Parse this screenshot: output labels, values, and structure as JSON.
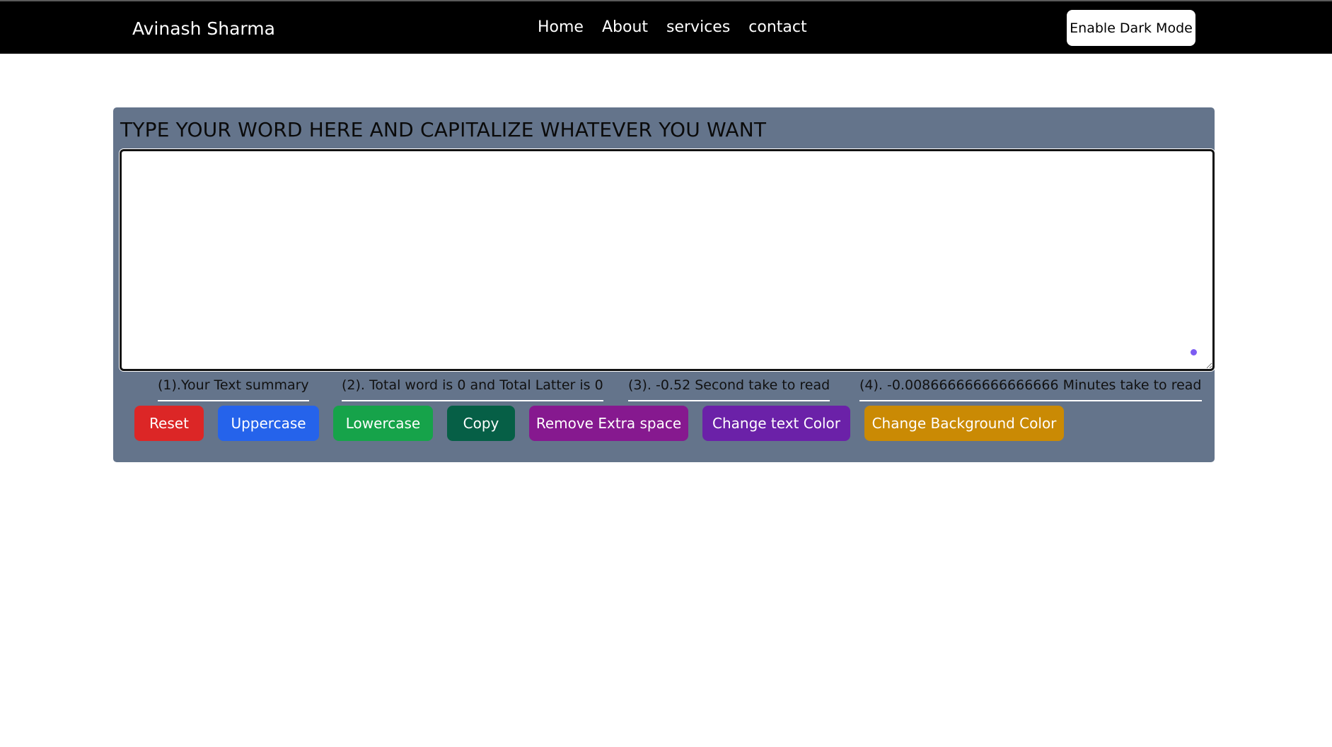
{
  "navbar": {
    "brand": "Avinash Sharma",
    "links": [
      "Home",
      "About",
      "services",
      "contact"
    ],
    "dark_mode_label": "Enable Dark Mode"
  },
  "panel": {
    "title": "TYPE YOUR WORD HERE AND CAPITALIZE WHATEVER YOU WANT",
    "textarea_value": "",
    "summary": [
      "(1).Your Text summary",
      "(2). Total word is 0 and Total Latter is 0",
      "(3). -0.52 Second take to read",
      "(4). -0.008666666666666666 Minutes take to read"
    ],
    "buttons": [
      {
        "label": "Reset",
        "color": "#dc2626"
      },
      {
        "label": "Uppercase",
        "color": "#2563eb"
      },
      {
        "label": "Lowercase",
        "color": "#16a34a"
      },
      {
        "label": "Copy",
        "color": "#065f46"
      },
      {
        "label": "Remove Extra space",
        "color": "#86198f"
      },
      {
        "label": "Change text Color",
        "color": "#6b21a8"
      },
      {
        "label": "Change Background Color",
        "color": "#ca8a04"
      }
    ]
  },
  "colors": {
    "navbar_bg": "#000000",
    "panel_bg": "#64748b",
    "resize_dot": "#7c5cf2"
  }
}
